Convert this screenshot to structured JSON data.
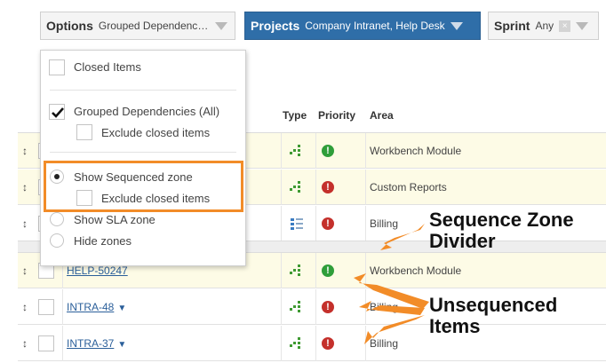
{
  "filters": {
    "options": {
      "label": "Options",
      "value": "Grouped Dependencies (All)"
    },
    "projects": {
      "label": "Projects",
      "value": "Company Intranet, Help Desk"
    },
    "sprint": {
      "label": "Sprint",
      "value": "Any",
      "clear": "×"
    }
  },
  "options_menu": {
    "closed_items": "Closed Items",
    "grouped_dependencies": "Grouped Dependencies (All)",
    "exclude_closed_1": "Exclude closed items",
    "show_sequenced_zone": "Show Sequenced zone",
    "exclude_closed_2": "Exclude closed items",
    "show_sla_zone": "Show SLA zone",
    "hide_zones": "Hide zones"
  },
  "table": {
    "headers": {
      "type": "Type",
      "priority": "Priority",
      "area": "Area"
    },
    "rows": [
      {
        "key": "",
        "area": "Workbench Module",
        "priority": "green",
        "priority_glyph": "!",
        "type_icon": "dependency-icon",
        "highlight": true
      },
      {
        "key": "",
        "area": "Custom Reports",
        "priority": "red",
        "priority_glyph": "!",
        "type_icon": "dependency-icon",
        "highlight": true
      },
      {
        "key": "",
        "area": "Billing",
        "priority": "red",
        "priority_glyph": "!",
        "type_icon": "list-icon",
        "highlight": false
      },
      {
        "key": "HELP-50247",
        "area": "Workbench Module",
        "priority": "green",
        "priority_glyph": "!",
        "type_icon": "dependency-icon",
        "highlight": true
      },
      {
        "key": "INTRA-48",
        "area": "Billing",
        "priority": "red",
        "priority_glyph": "!",
        "type_icon": "dependency-icon",
        "highlight": false
      },
      {
        "key": "INTRA-37",
        "area": "Billing",
        "priority": "red",
        "priority_glyph": "!",
        "type_icon": "dependency-icon",
        "highlight": false
      }
    ],
    "drag_glyph": "↕",
    "dropdown_glyph": "▼"
  },
  "annotations": {
    "sequence_zone_divider": [
      "Sequence Zone",
      "Divider"
    ],
    "unsequenced_items": [
      "Unsequenced",
      "Items"
    ]
  },
  "colors": {
    "projects_filter_bg": "#2f6ea8",
    "highlight_border": "#f28c28",
    "arrow": "#f28c28",
    "priority_green": "#2f9e3a",
    "priority_red": "#c4302b",
    "row_highlight": "#fdfbe6"
  }
}
